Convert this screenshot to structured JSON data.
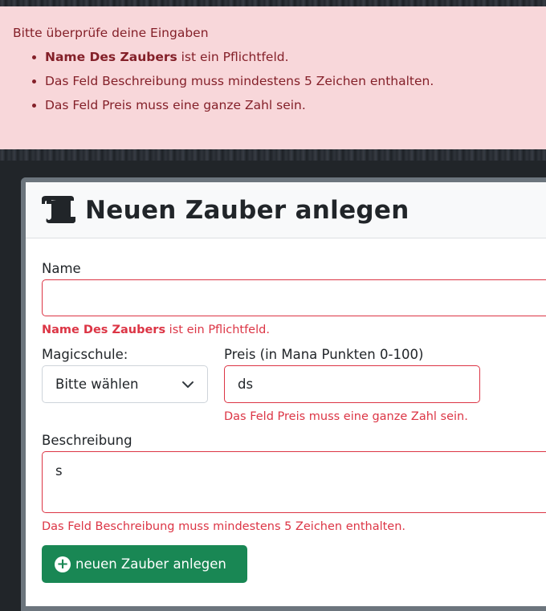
{
  "alert": {
    "heading": "Bitte überprüfe deine Eingaben",
    "items": [
      {
        "bold": "Name Des Zaubers",
        "text": " ist ein Pflichtfeld."
      },
      {
        "bold": "",
        "text": "Das Feld Beschreibung muss mindestens 5 Zeichen enthalten."
      },
      {
        "bold": "",
        "text": "Das Feld Preis muss eine ganze Zahl sein."
      }
    ]
  },
  "card": {
    "title": "Neuen Zauber anlegen",
    "icon": "scroll-icon"
  },
  "form": {
    "name": {
      "label": "Name",
      "value": "",
      "error_bold": "Name Des Zaubers",
      "error_text": " ist ein Pflichtfeld."
    },
    "school": {
      "label": "Magicschule:",
      "selected": "Bitte wählen"
    },
    "price": {
      "label": "Preis (in Mana Punkten 0-100)",
      "value": "ds",
      "error": "Das Feld Preis muss eine ganze Zahl sein."
    },
    "description": {
      "label": "Beschreibung",
      "value": "s",
      "error": "Das Feld Beschreibung muss mindestens 5 Zeichen enthalten."
    },
    "submit_label": "neuen Zauber anlegen"
  },
  "colors": {
    "alert_bg": "#f8d7da",
    "alert_text": "#842029",
    "error": "#dc3545",
    "success": "#198754",
    "dark_bg": "#212529"
  }
}
